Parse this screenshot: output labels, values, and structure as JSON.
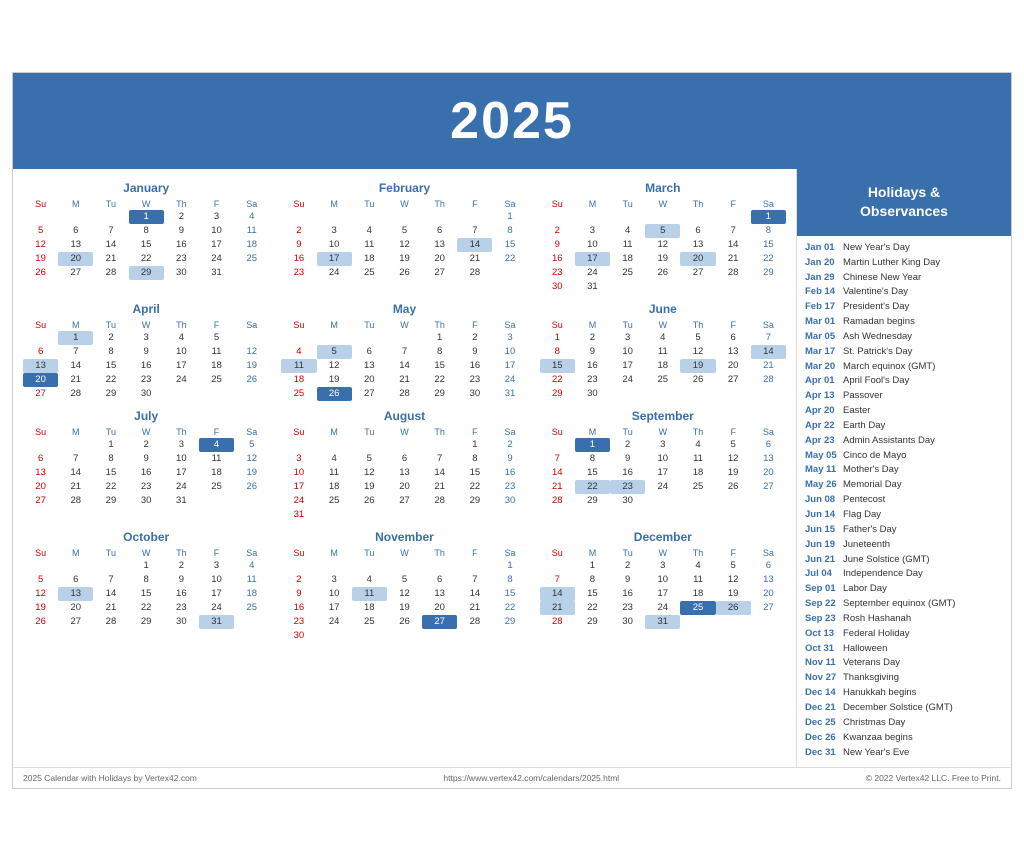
{
  "header": {
    "year": "2025"
  },
  "sidebar": {
    "title": "Holidays &\nObservances",
    "holidays": [
      {
        "date": "Jan 01",
        "name": "New Year's Day"
      },
      {
        "date": "Jan 20",
        "name": "Martin Luther King Day"
      },
      {
        "date": "Jan 29",
        "name": "Chinese New Year"
      },
      {
        "date": "Feb 14",
        "name": "Valentine's Day"
      },
      {
        "date": "Feb 17",
        "name": "President's Day"
      },
      {
        "date": "Mar 01",
        "name": "Ramadan begins"
      },
      {
        "date": "Mar 05",
        "name": "Ash Wednesday"
      },
      {
        "date": "Mar 17",
        "name": "St. Patrick's Day"
      },
      {
        "date": "Mar 20",
        "name": "March equinox (GMT)"
      },
      {
        "date": "Apr 01",
        "name": "April Fool's Day"
      },
      {
        "date": "Apr 13",
        "name": "Passover"
      },
      {
        "date": "Apr 20",
        "name": "Easter"
      },
      {
        "date": "Apr 22",
        "name": "Earth Day"
      },
      {
        "date": "Apr 23",
        "name": "Admin Assistants Day"
      },
      {
        "date": "May 05",
        "name": "Cinco de Mayo"
      },
      {
        "date": "May 11",
        "name": "Mother's Day"
      },
      {
        "date": "May 26",
        "name": "Memorial Day"
      },
      {
        "date": "Jun 08",
        "name": "Pentecost"
      },
      {
        "date": "Jun 14",
        "name": "Flag Day"
      },
      {
        "date": "Jun 15",
        "name": "Father's Day"
      },
      {
        "date": "Jun 19",
        "name": "Juneteenth"
      },
      {
        "date": "Jun 21",
        "name": "June Solstice (GMT)"
      },
      {
        "date": "Jul 04",
        "name": "Independence Day"
      },
      {
        "date": "Sep 01",
        "name": "Labor Day"
      },
      {
        "date": "Sep 22",
        "name": "September equinox (GMT)"
      },
      {
        "date": "Sep 23",
        "name": "Rosh Hashanah"
      },
      {
        "date": "Oct 13",
        "name": "Federal Holiday"
      },
      {
        "date": "Oct 31",
        "name": "Halloween"
      },
      {
        "date": "Nov 11",
        "name": "Veterans Day"
      },
      {
        "date": "Nov 27",
        "name": "Thanksgiving"
      },
      {
        "date": "Dec 14",
        "name": "Hanukkah begins"
      },
      {
        "date": "Dec 21",
        "name": "December Solstice (GMT)"
      },
      {
        "date": "Dec 25",
        "name": "Christmas Day"
      },
      {
        "date": "Dec 26",
        "name": "Kwanzaa begins"
      },
      {
        "date": "Dec 31",
        "name": "New Year's Eve"
      }
    ]
  },
  "footer": {
    "left": "2025 Calendar with Holidays by Vertex42.com",
    "center": "https://www.vertex42.com/calendars/2025.html",
    "right": "© 2022 Vertex42 LLC. Free to Print."
  },
  "months": [
    {
      "name": "January",
      "weeks": [
        [
          "",
          "",
          "",
          "1",
          "2",
          "3",
          "4"
        ],
        [
          "5",
          "6",
          "7",
          "8",
          "9",
          "10",
          "11"
        ],
        [
          "12",
          "13",
          "14",
          "15",
          "16",
          "17",
          "18"
        ],
        [
          "19",
          "20",
          "21",
          "22",
          "23",
          "24",
          "25"
        ],
        [
          "26",
          "27",
          "28",
          "29",
          "30",
          "31",
          ""
        ]
      ],
      "highlights": {
        "1": "holiday",
        "20": "blue",
        "29": "blue"
      },
      "sundays": [
        "5",
        "12",
        "19",
        "26"
      ],
      "saturdays": [
        "4",
        "11",
        "18",
        "25"
      ]
    },
    {
      "name": "February",
      "weeks": [
        [
          "",
          "",
          "",
          "",
          "",
          "",
          "1"
        ],
        [
          "2",
          "3",
          "4",
          "5",
          "6",
          "7",
          "8"
        ],
        [
          "9",
          "10",
          "11",
          "12",
          "13",
          "14",
          "15"
        ],
        [
          "16",
          "17",
          "18",
          "19",
          "20",
          "21",
          "22"
        ],
        [
          "23",
          "24",
          "25",
          "26",
          "27",
          "28",
          ""
        ]
      ],
      "highlights": {
        "14": "blue",
        "17": "blue"
      },
      "sundays": [
        "2",
        "9",
        "16",
        "23"
      ],
      "saturdays": [
        "1",
        "8",
        "15",
        "22"
      ]
    },
    {
      "name": "March",
      "weeks": [
        [
          "",
          "",
          "",
          "",
          "",
          "",
          "1"
        ],
        [
          "2",
          "3",
          "4",
          "5",
          "6",
          "7",
          "8"
        ],
        [
          "9",
          "10",
          "11",
          "12",
          "13",
          "14",
          "15"
        ],
        [
          "16",
          "17",
          "18",
          "19",
          "20",
          "21",
          "22"
        ],
        [
          "23",
          "24",
          "25",
          "26",
          "27",
          "28",
          "29"
        ],
        [
          "30",
          "31",
          "",
          "",
          "",
          "",
          ""
        ]
      ],
      "highlights": {
        "1": "holiday",
        "5": "blue",
        "17": "blue",
        "20": "blue"
      },
      "sundays": [
        "2",
        "9",
        "16",
        "23",
        "30"
      ],
      "saturdays": [
        "1",
        "8",
        "15",
        "22",
        "29"
      ]
    },
    {
      "name": "April",
      "weeks": [
        [
          "",
          "1",
          "2",
          "3",
          "4",
          "5",
          ""
        ],
        [
          "6",
          "7",
          "8",
          "9",
          "10",
          "11",
          "12"
        ],
        [
          "13",
          "14",
          "15",
          "16",
          "17",
          "18",
          "19"
        ],
        [
          "20",
          "21",
          "22",
          "23",
          "24",
          "25",
          "26"
        ],
        [
          "27",
          "28",
          "29",
          "30",
          "",
          "",
          ""
        ]
      ],
      "highlights": {
        "20": "holiday",
        "13": "blue",
        "1": "blue"
      },
      "sundays": [
        "6",
        "13",
        "20",
        "27"
      ],
      "saturdays": [
        "5",
        "12",
        "19",
        "26"
      ]
    },
    {
      "name": "May",
      "weeks": [
        [
          "",
          "",
          "",
          "",
          "1",
          "2",
          "3"
        ],
        [
          "4",
          "5",
          "6",
          "7",
          "8",
          "9",
          "10"
        ],
        [
          "11",
          "12",
          "13",
          "14",
          "15",
          "16",
          "17"
        ],
        [
          "18",
          "19",
          "20",
          "21",
          "22",
          "23",
          "24"
        ],
        [
          "25",
          "26",
          "27",
          "28",
          "29",
          "30",
          "31"
        ]
      ],
      "highlights": {
        "11": "blue",
        "26": "holiday",
        "5": "blue"
      },
      "sundays": [
        "4",
        "11",
        "18",
        "25"
      ],
      "saturdays": [
        "3",
        "10",
        "17",
        "24",
        "31"
      ]
    },
    {
      "name": "June",
      "weeks": [
        [
          "1",
          "2",
          "3",
          "4",
          "5",
          "6",
          "7"
        ],
        [
          "8",
          "9",
          "10",
          "11",
          "12",
          "13",
          "14"
        ],
        [
          "15",
          "16",
          "17",
          "18",
          "19",
          "20",
          "21"
        ],
        [
          "22",
          "23",
          "24",
          "25",
          "26",
          "27",
          "28"
        ],
        [
          "29",
          "30",
          "",
          "",
          "",
          "",
          ""
        ]
      ],
      "highlights": {
        "15": "blue",
        "19": "blue",
        "14": "blue"
      },
      "sundays": [
        "1",
        "8",
        "15",
        "22",
        "29"
      ],
      "saturdays": [
        "7",
        "14",
        "21",
        "28"
      ]
    },
    {
      "name": "July",
      "weeks": [
        [
          "",
          "",
          "1",
          "2",
          "3",
          "4",
          "5"
        ],
        [
          "6",
          "7",
          "8",
          "9",
          "10",
          "11",
          "12"
        ],
        [
          "13",
          "14",
          "15",
          "16",
          "17",
          "18",
          "19"
        ],
        [
          "20",
          "21",
          "22",
          "23",
          "24",
          "25",
          "26"
        ],
        [
          "27",
          "28",
          "29",
          "30",
          "31",
          "",
          ""
        ]
      ],
      "highlights": {
        "4": "holiday"
      },
      "sundays": [
        "6",
        "13",
        "20",
        "27"
      ],
      "saturdays": [
        "5",
        "12",
        "19",
        "26"
      ]
    },
    {
      "name": "August",
      "weeks": [
        [
          "",
          "",
          "",
          "",
          "",
          "1",
          "2"
        ],
        [
          "3",
          "4",
          "5",
          "6",
          "7",
          "8",
          "9"
        ],
        [
          "10",
          "11",
          "12",
          "13",
          "14",
          "15",
          "16"
        ],
        [
          "17",
          "18",
          "19",
          "20",
          "21",
          "22",
          "23"
        ],
        [
          "24",
          "25",
          "26",
          "27",
          "28",
          "29",
          "30"
        ],
        [
          "31",
          "",
          "",
          "",
          "",
          "",
          ""
        ]
      ],
      "highlights": {},
      "sundays": [
        "3",
        "10",
        "17",
        "24",
        "31"
      ],
      "saturdays": [
        "2",
        "9",
        "16",
        "23",
        "30"
      ]
    },
    {
      "name": "September",
      "weeks": [
        [
          "",
          "1",
          "2",
          "3",
          "4",
          "5",
          "6"
        ],
        [
          "7",
          "8",
          "9",
          "10",
          "11",
          "12",
          "13"
        ],
        [
          "14",
          "15",
          "16",
          "17",
          "18",
          "19",
          "20"
        ],
        [
          "21",
          "22",
          "23",
          "24",
          "25",
          "26",
          "27"
        ],
        [
          "28",
          "29",
          "30",
          "",
          "",
          "",
          ""
        ]
      ],
      "highlights": {
        "1": "holiday",
        "22": "blue",
        "23": "blue"
      },
      "sundays": [
        "7",
        "14",
        "21",
        "28"
      ],
      "saturdays": [
        "6",
        "13",
        "20",
        "27"
      ]
    },
    {
      "name": "October",
      "weeks": [
        [
          "",
          "",
          "",
          "1",
          "2",
          "3",
          "4"
        ],
        [
          "5",
          "6",
          "7",
          "8",
          "9",
          "10",
          "11"
        ],
        [
          "12",
          "13",
          "14",
          "15",
          "16",
          "17",
          "18"
        ],
        [
          "19",
          "20",
          "21",
          "22",
          "23",
          "24",
          "25"
        ],
        [
          "26",
          "27",
          "28",
          "29",
          "30",
          "31",
          ""
        ]
      ],
      "highlights": {
        "13": "blue",
        "31": "blue"
      },
      "sundays": [
        "5",
        "12",
        "19",
        "26"
      ],
      "saturdays": [
        "4",
        "11",
        "18",
        "25"
      ]
    },
    {
      "name": "November",
      "weeks": [
        [
          "",
          "",
          "",
          "",
          "",
          "",
          "1"
        ],
        [
          "2",
          "3",
          "4",
          "5",
          "6",
          "7",
          "8"
        ],
        [
          "9",
          "10",
          "11",
          "12",
          "13",
          "14",
          "15"
        ],
        [
          "16",
          "17",
          "18",
          "19",
          "20",
          "21",
          "22"
        ],
        [
          "23",
          "24",
          "25",
          "26",
          "27",
          "28",
          "29"
        ],
        [
          "30",
          "",
          "",
          "",
          "",
          "",
          ""
        ]
      ],
      "highlights": {
        "11": "blue",
        "27": "holiday"
      },
      "sundays": [
        "2",
        "9",
        "16",
        "23",
        "30"
      ],
      "saturdays": [
        "1",
        "8",
        "15",
        "22",
        "29"
      ]
    },
    {
      "name": "December",
      "weeks": [
        [
          "",
          "1",
          "2",
          "3",
          "4",
          "5",
          "6"
        ],
        [
          "7",
          "8",
          "9",
          "10",
          "11",
          "12",
          "13"
        ],
        [
          "14",
          "15",
          "16",
          "17",
          "18",
          "19",
          "20"
        ],
        [
          "21",
          "22",
          "23",
          "24",
          "25",
          "26",
          "27"
        ],
        [
          "28",
          "29",
          "30",
          "31",
          "",
          "",
          ""
        ]
      ],
      "highlights": {
        "25": "holiday",
        "14": "blue",
        "21": "blue",
        "26": "blue",
        "31": "blue"
      },
      "sundays": [
        "7",
        "14",
        "21",
        "28"
      ],
      "saturdays": [
        "6",
        "13",
        "20",
        "27"
      ]
    }
  ]
}
